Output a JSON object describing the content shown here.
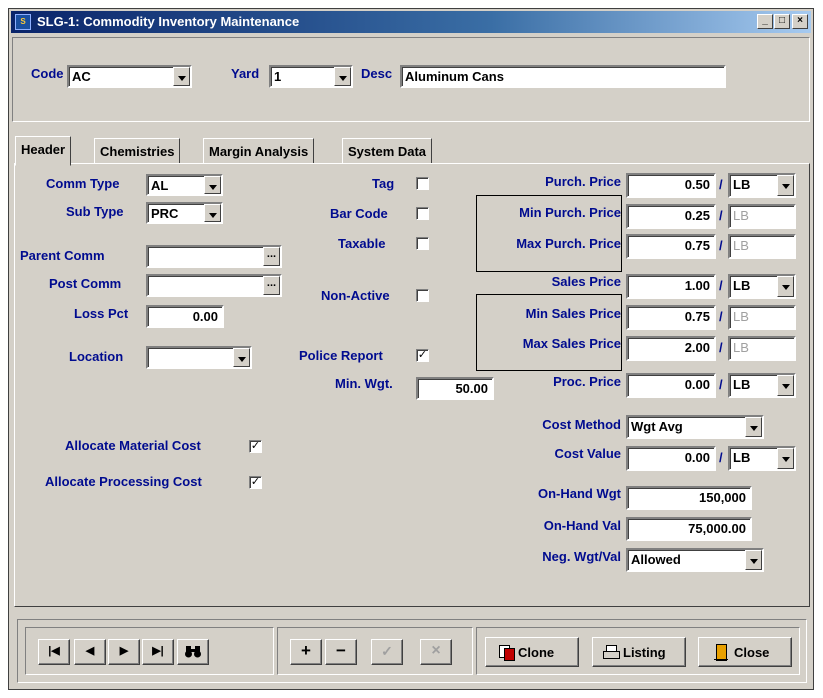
{
  "window": {
    "title": "SLG-1: Commodity Inventory Maintenance",
    "icon": "app-icon",
    "min": "_",
    "max": "□",
    "close": "×"
  },
  "top": {
    "code_label": "Code",
    "code_value": "AC",
    "yard_label": "Yard",
    "yard_value": "1",
    "desc_label": "Desc",
    "desc_value": "Aluminum Cans"
  },
  "tabs": [
    "Header",
    "Chemistries",
    "Margin Analysis",
    "System Data"
  ],
  "left": {
    "comm_type_label": "Comm Type",
    "comm_type_value": "AL",
    "sub_type_label": "Sub Type",
    "sub_type_value": "PRC",
    "parent_comm_label": "Parent Comm",
    "parent_comm_value": "",
    "post_comm_label": "Post Comm",
    "post_comm_value": "",
    "loss_pct_label": "Loss Pct",
    "loss_pct_value": "0.00",
    "location_label": "Location",
    "location_value": "",
    "alloc_material_label": "Allocate Material Cost",
    "alloc_material_checked": true,
    "alloc_processing_label": "Allocate Processing Cost",
    "alloc_processing_checked": true,
    "ellipsis": "..."
  },
  "middle": {
    "tag_label": "Tag",
    "tag_checked": false,
    "bar_code_label": "Bar Code",
    "bar_code_checked": false,
    "taxable_label": "Taxable",
    "taxable_checked": false,
    "non_active_label": "Non-Active",
    "non_active_checked": false,
    "police_report_label": "Police Report",
    "police_report_checked": true,
    "min_wgt_label": "Min. Wgt.",
    "min_wgt_value": "50.00"
  },
  "right": {
    "purch_price_label": "Purch. Price",
    "purch_price_value": "0.50",
    "purch_price_unit": "LB",
    "min_purch_label": "Min Purch. Price",
    "min_purch_value": "0.25",
    "min_purch_unit": "LB",
    "max_purch_label": "Max Purch. Price",
    "max_purch_value": "0.75",
    "max_purch_unit": "LB",
    "sales_price_label": "Sales Price",
    "sales_price_value": "1.00",
    "sales_price_unit": "LB",
    "min_sales_label": "Min Sales Price",
    "min_sales_value": "0.75",
    "min_sales_unit": "LB",
    "max_sales_label": "Max Sales Price",
    "max_sales_value": "2.00",
    "max_sales_unit": "LB",
    "proc_price_label": "Proc. Price",
    "proc_price_value": "0.00",
    "proc_price_unit": "LB",
    "cost_method_label": "Cost Method",
    "cost_method_value": "Wgt Avg",
    "cost_value_label": "Cost Value",
    "cost_value_value": "0.00",
    "cost_value_unit": "LB",
    "onhand_wgt_label": "On-Hand Wgt",
    "onhand_wgt_value": "150,000",
    "onhand_val_label": "On-Hand Val",
    "onhand_val_value": "75,000.00",
    "neg_label": "Neg. Wgt/Val",
    "neg_value": "Allowed",
    "slash": "/"
  },
  "bottom": {
    "nav": [
      "|◀",
      "◀",
      "▶",
      "▶|"
    ],
    "find_icon": "binoculars-icon",
    "edit": [
      "+",
      "−",
      "✓",
      "×"
    ],
    "clone_label": "Clone",
    "listing_label": "Listing",
    "close_label": "Close"
  }
}
